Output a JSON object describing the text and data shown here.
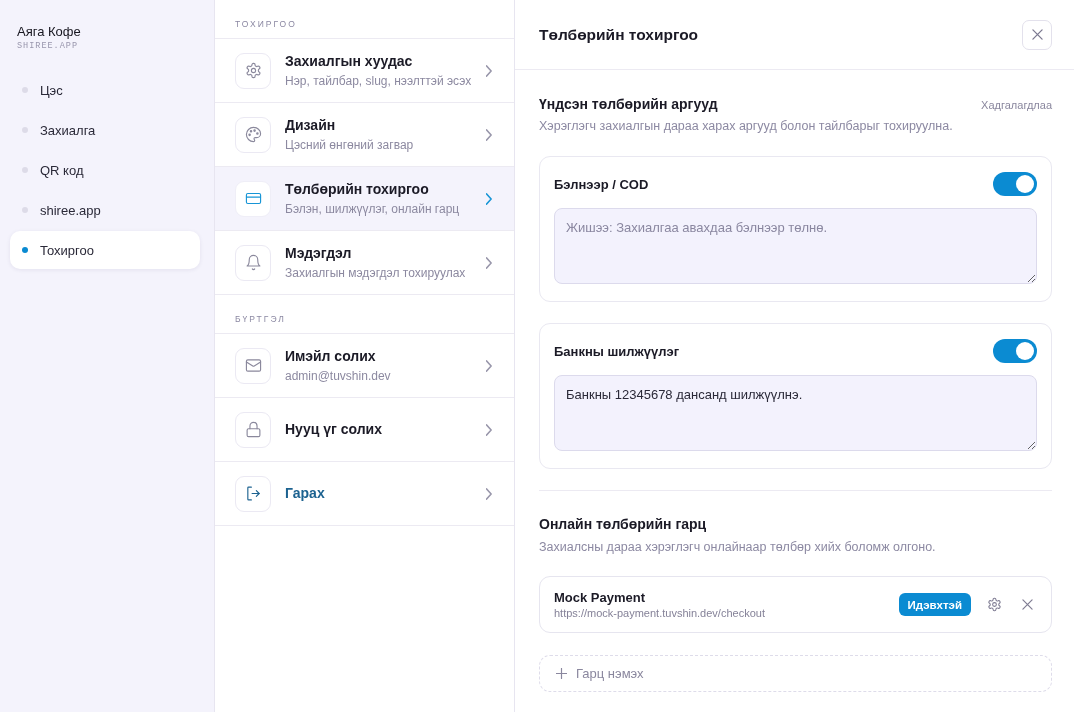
{
  "sidebar": {
    "brand": "Аяга Кофе",
    "domain": "SHIREE.APP",
    "items": [
      {
        "label": "Цэс",
        "selected": false
      },
      {
        "label": "Захиалга",
        "selected": false
      },
      {
        "label": "QR код",
        "selected": false
      },
      {
        "label": "shiree.app",
        "selected": false
      },
      {
        "label": "Тохиргоо",
        "selected": true
      }
    ]
  },
  "settings_menu": {
    "sections": [
      {
        "heading": "ТОХИРГОО",
        "items": [
          {
            "kind": "page",
            "title": "Захиалгын хуудас",
            "subtitle": "Нэр, тайлбар, slug, нээлттэй эсэх",
            "selected": false
          },
          {
            "kind": "design",
            "title": "Дизайн",
            "subtitle": "Цэсний өнгөний загвар",
            "selected": false
          },
          {
            "kind": "payment",
            "title": "Төлбөрийн тохиргоо",
            "subtitle": "Бэлэн, шилжүүлэг, онлайн гарц",
            "selected": true
          },
          {
            "kind": "notifications",
            "title": "Мэдэгдэл",
            "subtitle": "Захиалгын мэдэгдэл тохируулах",
            "selected": false
          }
        ]
      },
      {
        "heading": "БҮРТГЭЛ",
        "items": [
          {
            "kind": "email",
            "title": "Имэйл солих",
            "subtitle": "admin@tuvshin.dev",
            "selected": false
          },
          {
            "kind": "password",
            "title": "Нууц үг солих",
            "selected": false
          },
          {
            "kind": "logout",
            "title": "Гарах",
            "selected": false
          }
        ]
      }
    ]
  },
  "panel": {
    "title": "Төлбөрийн тохиргоо",
    "methods_section": {
      "title": "Үндсэн төлбөрийн аргууд",
      "status": "Хадгалагдлаа",
      "description": "Хэрэглэгч захиалгын дараа харах аргууд болон тайлбарыг тохируулна.",
      "methods": [
        {
          "name": "Бэлнээр / COD",
          "on": true,
          "placeholder": "Жишээ: Захиалгаа авахдаа бэлнээр төлнө."
        },
        {
          "name": "Банкны шилжүүлэг",
          "on": true,
          "value": "Банкны 12345678 дансанд шилжүүлнэ."
        }
      ]
    },
    "gateways_section": {
      "title": "Онлайн төлбөрийн гарц",
      "description": "Захиалсны дараа хэрэглэгч онлайнаар төлбөр хийх боломж олгоно.",
      "gateways": [
        {
          "name": "Mock Payment",
          "url": "https://mock-payment.tuvshin.dev/checkout",
          "status": "Идэвхтэй",
          "active": true
        }
      ],
      "add_label": "Гарц нэмэх"
    }
  }
}
